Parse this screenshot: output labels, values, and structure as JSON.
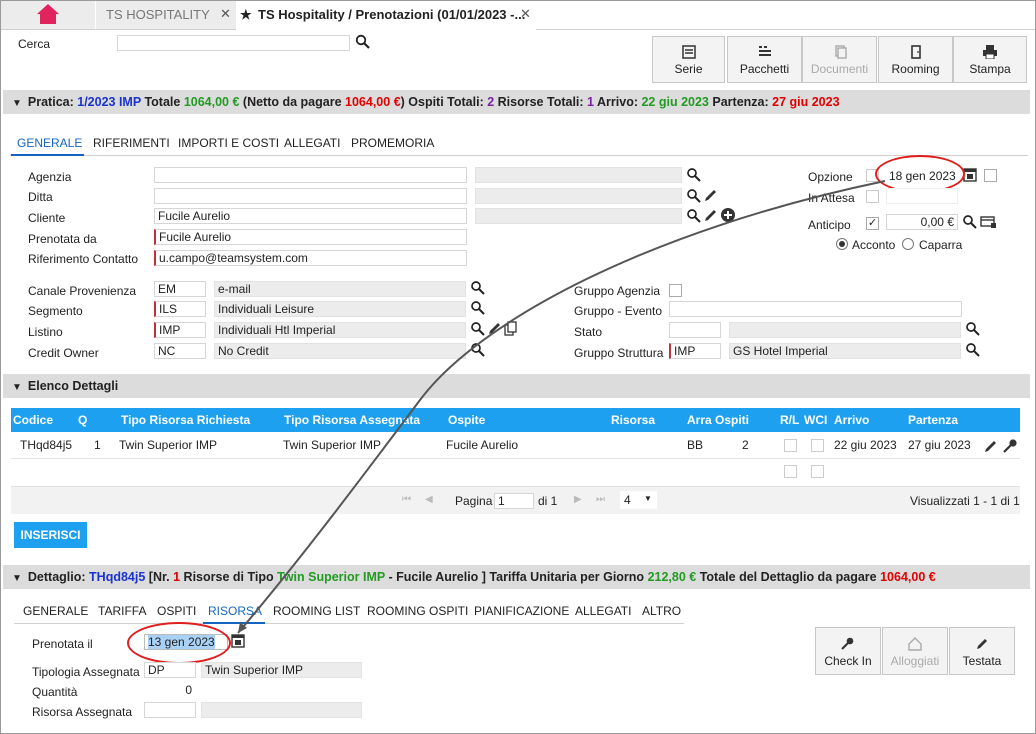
{
  "tabs": {
    "home_icon": "home-icon",
    "tab1_label": "TS HOSPITALITY",
    "tab2_label": "TS Hospitality / Prenotazioni (01/01/2023 -...",
    "close_glyph": "✕",
    "star_glyph": "★"
  },
  "search": {
    "label": "Cerca",
    "value": ""
  },
  "toolbar": {
    "serie": "Serie",
    "pacchetti": "Pacchetti",
    "documenti": "Documenti",
    "rooming": "Rooming",
    "stampa": "Stampa"
  },
  "pratica": {
    "label_pratica": "Pratica:",
    "number": "1/2023 IMP",
    "label_totale": "Totale",
    "totale": "1064,00 €",
    "label_netto": "(Netto da pagare",
    "netto": "1064,00 €",
    "label_ospiti": ") Ospiti Totali:",
    "ospiti": "2",
    "label_risorse": "Risorse Totali:",
    "risorse": "1",
    "label_arrivo": "Arrivo:",
    "arrivo": "22 giu 2023",
    "label_partenza": "Partenza:",
    "partenza": "27 giu 2023"
  },
  "main_tabs": [
    "GENERALE",
    "RIFERIMENTI",
    "IMPORTI E COSTI",
    "ALLEGATI",
    "PROMEMORIA"
  ],
  "form": {
    "agenzia": {
      "label": "Agenzia",
      "value": ""
    },
    "ditta": {
      "label": "Ditta",
      "value": ""
    },
    "cliente": {
      "label": "Cliente",
      "value": "Fucile Aurelio"
    },
    "prenotata_da": {
      "label": "Prenotata da",
      "value": "Fucile Aurelio"
    },
    "riferimento": {
      "label": "Riferimento Contatto",
      "value": "u.campo@teamsystem.com"
    },
    "canale": {
      "label": "Canale Provenienza",
      "code": "EM",
      "desc": "e-mail"
    },
    "segmento": {
      "label": "Segmento",
      "code": "ILS",
      "desc": "Individuali Leisure"
    },
    "listino": {
      "label": "Listino",
      "code": "IMP",
      "desc": "Individuali Htl Imperial"
    },
    "credit_owner": {
      "label": "Credit Owner",
      "code": "NC",
      "desc": "No Credit"
    },
    "gruppo_agenzia": {
      "label": "Gruppo Agenzia"
    },
    "gruppo_evento": {
      "label": "Gruppo - Evento",
      "value": ""
    },
    "stato": {
      "label": "Stato",
      "code": "",
      "desc": ""
    },
    "gruppo_struttura": {
      "label": "Gruppo Struttura",
      "code": "IMP",
      "desc": "GS Hotel Imperial"
    },
    "opzione": {
      "label": "Opzione",
      "value": "18 gen 2023"
    },
    "in_attesa": {
      "label": "In Attesa"
    },
    "anticipo": {
      "label": "Anticipo",
      "value": "0,00 €"
    },
    "acconto": "Acconto",
    "caparra": "Caparra"
  },
  "elenco": {
    "title": "Elenco Dettagli",
    "columns": [
      "Codice",
      "Q",
      "Tipo Risorsa Richiesta",
      "Tipo Risorsa Assegnata",
      "Ospite",
      "Risorsa",
      "Arra",
      "Ospiti",
      "R/L",
      "WCI",
      "Arrivo",
      "Partenza"
    ],
    "rows": [
      [
        "THqd84j5",
        "1",
        "Twin Superior IMP",
        "Twin Superior IMP",
        "Fucile Aurelio",
        "",
        "BB",
        "2",
        "",
        "",
        "22 giu 2023",
        "27 giu 2023"
      ]
    ],
    "pager": {
      "page_label": "Pagina",
      "page": "1",
      "of": "di 1",
      "size": "4",
      "summary": "Visualizzati 1 - 1 di 1"
    },
    "insert": "INSERISCI"
  },
  "dettaglio": {
    "label": "Dettaglio:",
    "code": "THqd84j5",
    "t1": "[Nr.",
    "nr": "1",
    "t2": "Risorse di Tipo",
    "tipo": "Twin Superior IMP",
    "t3": "- Fucile Aurelio ] Tariffa Unitaria per Giorno",
    "tariffa": "212,80 €",
    "t4": "Totale del Dettaglio da pagare",
    "totale": "1064,00 €"
  },
  "detail_tabs": [
    "GENERALE",
    "TARIFFA",
    "OSPITI",
    "RISORSA",
    "ROOMING LIST",
    "ROOMING OSPITI",
    "PIANIFICAZIONE",
    "ALLEGATI",
    "ALTRO"
  ],
  "risorsa": {
    "prenotata_il": {
      "label": "Prenotata il",
      "value": "13 gen 2023"
    },
    "tipologia": {
      "label": "Tipologia Assegnata",
      "code": "DP",
      "desc": "Twin Superior IMP"
    },
    "quantita": {
      "label": "Quantità",
      "value": "0"
    },
    "assegnata": {
      "label": "Risorsa Assegnata",
      "code": "",
      "desc": ""
    }
  },
  "actions": {
    "checkin": "Check In",
    "alloggiati": "Alloggiati",
    "testata": "Testata"
  },
  "colors": {
    "accent": "#1ea0f0",
    "tab_blue": "#1565c0",
    "highlight": "#e01e1e",
    "home": "#e0245e"
  }
}
